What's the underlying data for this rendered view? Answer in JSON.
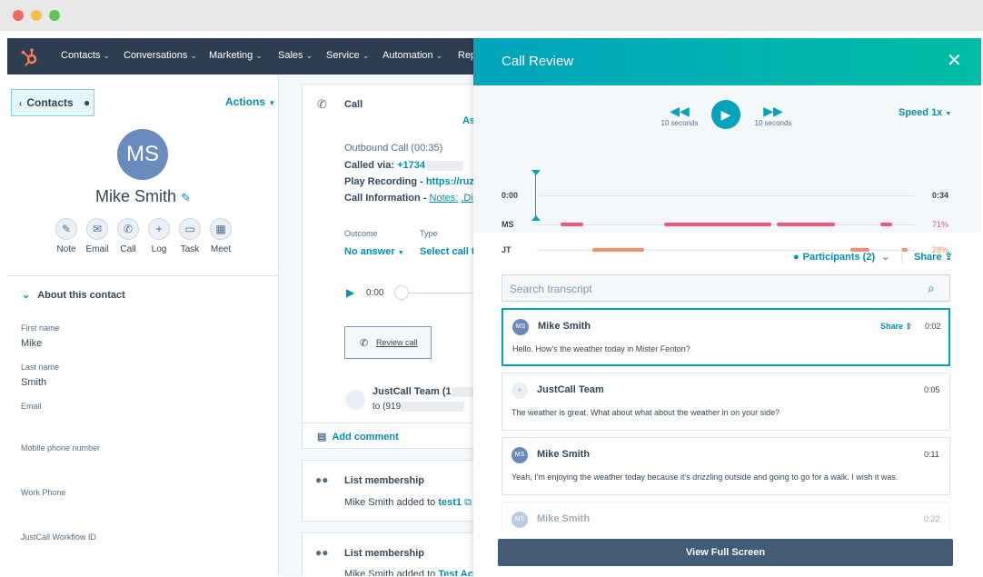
{
  "window": {
    "dots": [
      "#ed6a5e",
      "#f5bf4f",
      "#61c554"
    ]
  },
  "nav": {
    "items": [
      "Contacts",
      "Conversations",
      "Marketing",
      "Sales",
      "Service",
      "Automation",
      "Rep"
    ]
  },
  "contact": {
    "back_label": "Contacts",
    "actions_label": "Actions",
    "initials": "MS",
    "name": "Mike Smith",
    "quick_actions": [
      "Note",
      "Email",
      "Call",
      "Log",
      "Task",
      "Meet"
    ],
    "about_title": "About this contact",
    "fields": [
      {
        "label": "First name",
        "value": "Mike"
      },
      {
        "label": "Last name",
        "value": "Smith"
      },
      {
        "label": "Email",
        "value": ""
      },
      {
        "label": "Mobile phone number",
        "value": ""
      },
      {
        "label": "Work Phone",
        "value": ""
      },
      {
        "label": "JustCall Workflow ID",
        "value": ""
      }
    ]
  },
  "activity": {
    "call_title": "Call",
    "assoc_fragment": "As",
    "outbound": "Outbound Call (00:35)",
    "called_via_label": "Called via:",
    "called_via_value": "+1734",
    "play_recording_label": "Play Recording -",
    "play_recording_value": "https://ruzg",
    "call_info_label": "Call Information -",
    "call_info_notes": "Notes:",
    "call_info_dis": ",Dis",
    "outcome_label": "Outcome",
    "outcome_value": "No answer",
    "type_label": "Type",
    "type_value": "Select call ty",
    "player_time": "0:00",
    "review_label": "Review call",
    "team_line1": "JustCall Team (1",
    "team_line2": "to (919",
    "add_comment": "Add comment",
    "list_title": "List membership",
    "list_text": "Mike Smith added to",
    "list_link": "test1",
    "list2_title": "List membership",
    "list2_text": "Mike Smith added to",
    "list2_link": "Test Ac"
  },
  "review": {
    "title": "Call Review",
    "skip_back": "10 seconds",
    "skip_fwd": "10 seconds",
    "speed": "Speed 1x",
    "time_start": "0:00",
    "time_end": "0:34",
    "tracks": [
      {
        "label": "MS",
        "percent": "71%",
        "color": "#f2547d"
      },
      {
        "label": "JT",
        "percent": "28%",
        "color": "#f0916a"
      }
    ],
    "participants": "Participants (2)",
    "share": "Share",
    "search_placeholder": "Search transcript",
    "entries": [
      {
        "initials": "MS",
        "speaker": "Mike Smith",
        "share": "Share",
        "time": "0:02",
        "text": "Hello. How's the weather today in Mister Fenton?"
      },
      {
        "initials": "",
        "speaker": "JustCall Team",
        "share": "",
        "time": "0:05",
        "text": "The weather is great. What about what about the weather in on your side?"
      },
      {
        "initials": "MS",
        "speaker": "Mike Smith",
        "share": "",
        "time": "0:11",
        "text": "Yeah, I'm enjoying the weather today because it's drizzling outside and going to go for a walk. I wish it was."
      },
      {
        "initials": "MS",
        "speaker": "Mike Smith",
        "share": "",
        "time": "0:22",
        "text": ""
      }
    ],
    "full_screen": "View Full Screen"
  }
}
